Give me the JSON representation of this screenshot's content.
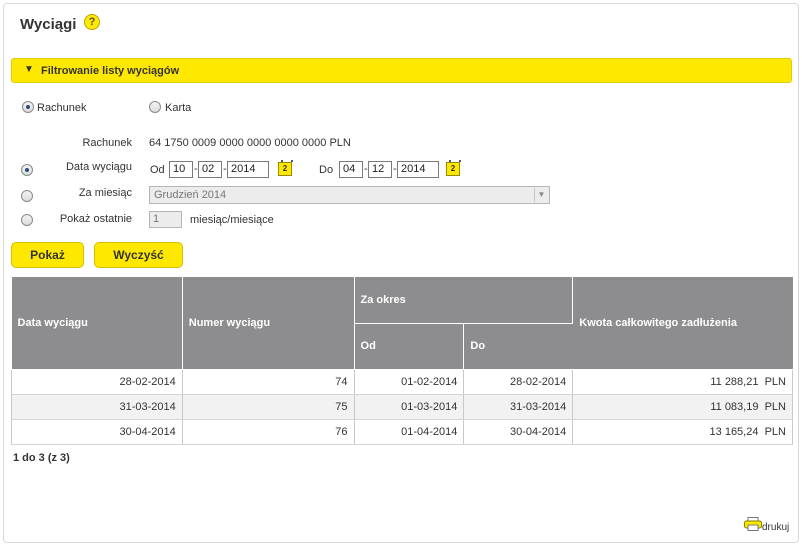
{
  "header": {
    "title": "Wyciągi",
    "help": "?"
  },
  "filter": {
    "section_label": "Filtrowanie listy wyciągów",
    "type_rachunek": "Rachunek",
    "type_karta": "Karta",
    "account_label": "Rachunek",
    "account_value": "64 1750 0009 0000 0000 0000 0000 PLN",
    "date_label": "Data wyciągu",
    "from_label": "Od",
    "from_day": "10",
    "from_month": "02",
    "from_year": "2014",
    "to_label": "Do",
    "to_day": "04",
    "to_month": "12",
    "to_year": "2014",
    "calendar_badge": "2",
    "month_label": "Za miesiąc",
    "month_value": "Grudzień 2014",
    "last_label": "Pokaż ostatnie",
    "last_value": "1",
    "last_unit": "miesiąc/miesiące",
    "show_button": "Pokaż",
    "clear_button": "Wyczyść"
  },
  "table": {
    "headers": {
      "date": "Data wyciągu",
      "number": "Numer wyciągu",
      "period": "Za okres",
      "from": "Od",
      "to": "Do",
      "debt": "Kwota całkowitego zadłużenia"
    },
    "rows": [
      {
        "date": "28-02-2014",
        "number": "74",
        "from": "01-02-2014",
        "to": "28-02-2014",
        "amount": "11 288,21",
        "currency": "PLN"
      },
      {
        "date": "31-03-2014",
        "number": "75",
        "from": "01-03-2014",
        "to": "31-03-2014",
        "amount": "11 083,19",
        "currency": "PLN"
      },
      {
        "date": "30-04-2014",
        "number": "76",
        "from": "01-04-2014",
        "to": "30-04-2014",
        "amount": "13 165,24",
        "currency": "PLN"
      }
    ]
  },
  "pagination": {
    "summary": "1 do 3 (z 3)"
  },
  "footer": {
    "print_label": "drukuj"
  },
  "colors": {
    "accent": "#ffe800",
    "table_header": "#8d8d8f"
  }
}
